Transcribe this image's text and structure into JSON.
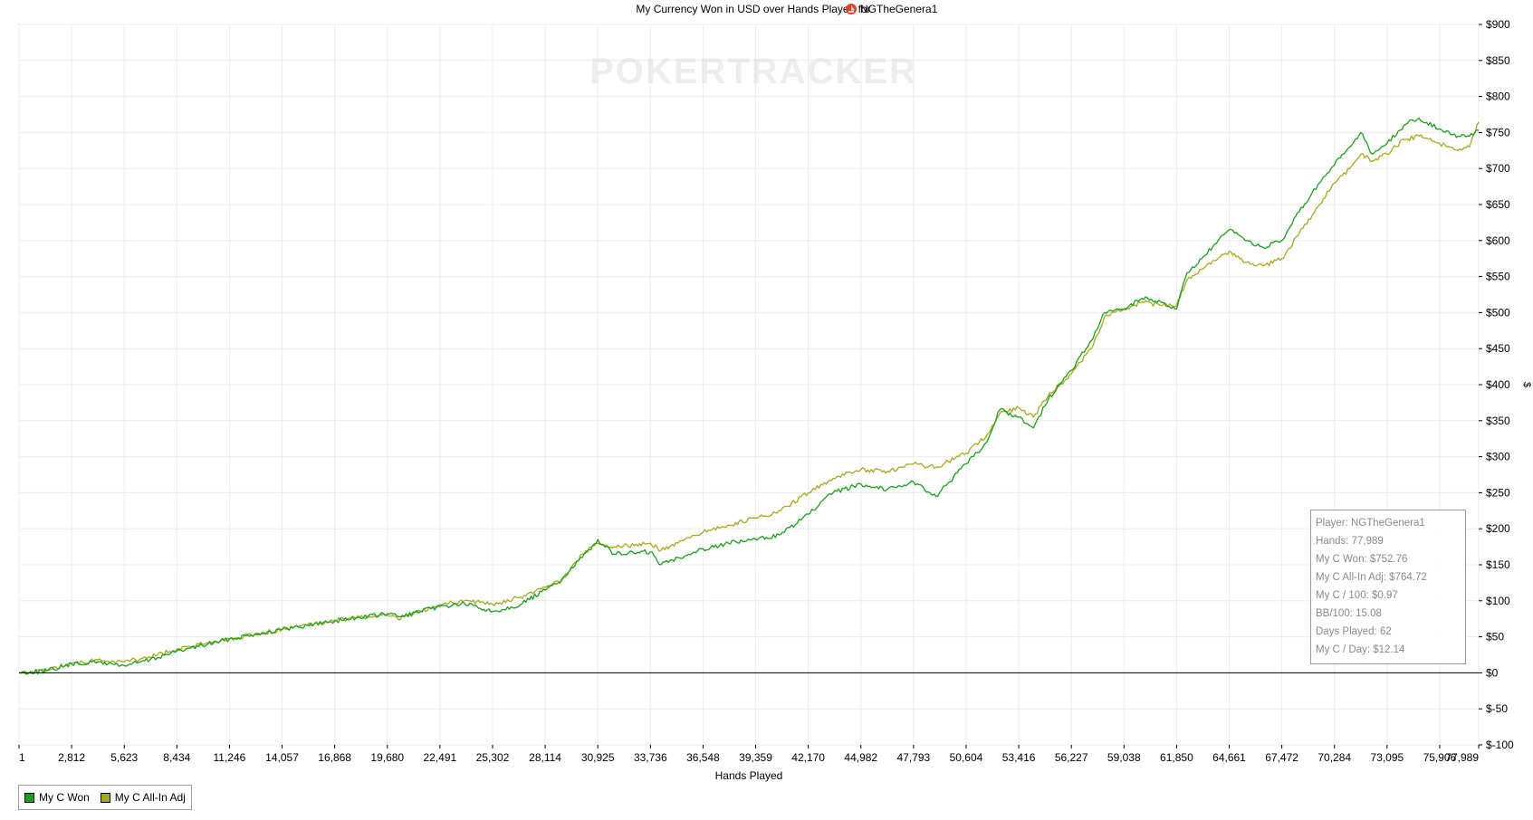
{
  "chart_data": {
    "type": "line",
    "title": "My Currency Won in USD over Hands Played for",
    "player_name": "NGTheGenera1",
    "xlabel": "Hands Played",
    "ylabel": "$",
    "xlim": [
      1,
      77989
    ],
    "ylim": [
      -100,
      900
    ],
    "x_ticks": [
      "1",
      "2,812",
      "5,623",
      "8,434",
      "11,246",
      "14,057",
      "16,868",
      "19,680",
      "22,491",
      "25,302",
      "28,114",
      "30,925",
      "33,736",
      "36,548",
      "39,359",
      "42,170",
      "44,982",
      "47,793",
      "50,604",
      "53,416",
      "56,227",
      "59,038",
      "61,850",
      "64,661",
      "67,472",
      "70,284",
      "73,095",
      "75,906",
      "77,989"
    ],
    "y_ticks": [
      "$900",
      "$850",
      "$800",
      "$750",
      "$700",
      "$650",
      "$600",
      "$550",
      "$500",
      "$450",
      "$400",
      "$350",
      "$300",
      "$250",
      "$200",
      "$150",
      "$100",
      "$50",
      "$0",
      "$-50",
      "$-100"
    ],
    "y_tick_values": [
      900,
      850,
      800,
      750,
      700,
      650,
      600,
      550,
      500,
      450,
      400,
      350,
      300,
      250,
      200,
      150,
      100,
      50,
      0,
      -50,
      -100
    ],
    "grid": true,
    "legend_position": "bottom-left",
    "watermark": "POKERTRACKER",
    "series": [
      {
        "name": "My C Won",
        "color": "#1aa01a",
        "x": [
          1,
          1500,
          2812,
          4200,
          5623,
          7000,
          8434,
          9800,
          11246,
          12600,
          14057,
          15400,
          16868,
          18200,
          19680,
          20400,
          22491,
          23800,
          25302,
          26800,
          28114,
          29000,
          30100,
          30925,
          31800,
          33736,
          34300,
          35200,
          36548,
          37900,
          39359,
          40700,
          42170,
          43500,
          44982,
          46400,
          47793,
          49000,
          50604,
          51700,
          52400,
          53416,
          54200,
          55000,
          56227,
          57400,
          58000,
          59038,
          60000,
          61000,
          61850,
          62400,
          63200,
          64661,
          65600,
          66500,
          67472,
          68400,
          69500,
          70284,
          71100,
          71700,
          72300,
          73095,
          74000,
          74800,
          75906,
          76900,
          77500,
          77989
        ],
        "y": [
          0,
          3,
          12,
          15,
          10,
          18,
          30,
          38,
          47,
          54,
          60,
          66,
          72,
          77,
          82,
          78,
          92,
          96,
          85,
          95,
          115,
          130,
          160,
          185,
          165,
          168,
          150,
          160,
          172,
          180,
          185,
          192,
          220,
          250,
          262,
          255,
          265,
          245,
          290,
          320,
          365,
          355,
          340,
          380,
          420,
          465,
          500,
          505,
          520,
          515,
          505,
          555,
          575,
          615,
          600,
          590,
          600,
          640,
          680,
          705,
          730,
          750,
          720,
          735,
          760,
          770,
          755,
          745,
          745,
          752.76
        ]
      },
      {
        "name": "My C All-In Adj",
        "color": "#a8a820",
        "x": [
          1,
          1500,
          2812,
          4200,
          5623,
          7000,
          8434,
          9800,
          11246,
          12600,
          14057,
          15400,
          16868,
          18200,
          19680,
          20400,
          22491,
          23800,
          25302,
          26800,
          28114,
          29000,
          30100,
          30925,
          31800,
          33736,
          34300,
          35200,
          36548,
          37900,
          39359,
          40700,
          42170,
          43500,
          44982,
          46400,
          47793,
          49000,
          50604,
          51700,
          52400,
          53416,
          54200,
          55000,
          56227,
          57400,
          58000,
          59038,
          60000,
          61000,
          61850,
          62400,
          63200,
          64661,
          65600,
          66500,
          67472,
          68400,
          69500,
          70284,
          71100,
          71700,
          72300,
          73095,
          74000,
          74800,
          75906,
          76900,
          77500,
          77989
        ],
        "y": [
          0,
          4,
          14,
          18,
          15,
          22,
          33,
          40,
          47,
          54,
          60,
          66,
          73,
          77,
          80,
          75,
          95,
          100,
          95,
          105,
          118,
          128,
          165,
          180,
          175,
          180,
          170,
          180,
          195,
          205,
          215,
          225,
          250,
          270,
          282,
          280,
          290,
          285,
          305,
          330,
          360,
          368,
          355,
          385,
          415,
          455,
          495,
          505,
          515,
          510,
          510,
          545,
          560,
          585,
          570,
          565,
          575,
          610,
          650,
          680,
          700,
          720,
          710,
          720,
          740,
          745,
          735,
          725,
          730,
          764.72
        ]
      }
    ]
  },
  "stats_box": {
    "player": "Player: NGTheGenera1",
    "hands": "Hands: 77,989",
    "won": "My C Won: $752.76",
    "all_in_adj": "My C All-In Adj: $764.72",
    "per_100": "My C / 100: $0.97",
    "bb_100": "BB/100: 15.08",
    "days": "Days Played: 62",
    "per_day": "My C / Day: $12.14"
  },
  "legend": {
    "won": "My C Won",
    "adj": "My C All-In Adj"
  },
  "colors": {
    "won": "#1aa01a",
    "adj": "#a8a820",
    "grid": "#ececec",
    "axis": "#000000"
  }
}
